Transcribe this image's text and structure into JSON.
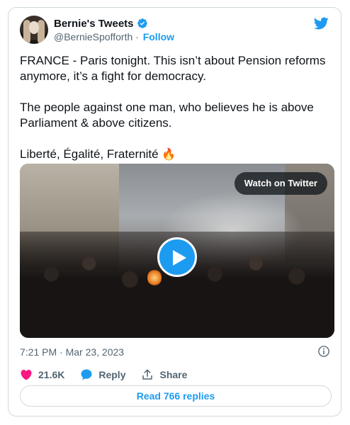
{
  "author": {
    "name": "Bernie's Tweets",
    "handle": "@BernieSpofforth",
    "separator": "·",
    "follow_label": "Follow"
  },
  "tweet": {
    "paragraphs": [
      "FRANCE - Paris tonight. This isn’t about Pension reforms anymore, it’s a fight for democracy.",
      "The people against one man, who believes he is above Parliament & above citizens.",
      "Liberté, Égalité, Fraternité"
    ],
    "emoji": "🔥"
  },
  "media": {
    "watch_label": "Watch on Twitter"
  },
  "meta": {
    "timestamp": "7:21 PM · Mar 23, 2023"
  },
  "actions": {
    "likes": "21.6K",
    "reply_label": "Reply",
    "share_label": "Share"
  },
  "replies": {
    "label": "Read 766 replies"
  },
  "colors": {
    "accent": "#1d9bf0",
    "like": "#f91880",
    "text": "#0f1419",
    "muted": "#536471",
    "border": "#cfd9de"
  },
  "icons": [
    "avatar",
    "verified-badge-icon",
    "twitter-bird-icon",
    "play-icon",
    "info-icon",
    "heart-icon",
    "reply-bubble-icon",
    "share-icon"
  ]
}
